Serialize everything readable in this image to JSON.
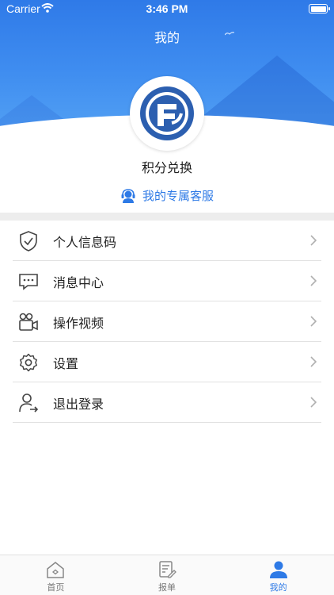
{
  "status_bar": {
    "carrier": "Carrier",
    "time": "3:46 PM"
  },
  "nav": {
    "title": "我的"
  },
  "profile": {
    "points_label": "积分兑换",
    "service_label": "我的专属客服"
  },
  "menu": [
    {
      "label": "个人信息码",
      "icon": "shield-check-icon"
    },
    {
      "label": "消息中心",
      "icon": "message-icon"
    },
    {
      "label": "操作视频",
      "icon": "video-camera-icon"
    },
    {
      "label": "设置",
      "icon": "gear-icon"
    },
    {
      "label": "退出登录",
      "icon": "logout-user-icon"
    }
  ],
  "tabs": [
    {
      "label": "首页",
      "icon": "home-icon",
      "active": false
    },
    {
      "label": "报单",
      "icon": "form-edit-icon",
      "active": false
    },
    {
      "label": "我的",
      "icon": "user-icon",
      "active": true
    }
  ],
  "colors": {
    "accent": "#2e7ae6",
    "header": "#3f8df0"
  }
}
